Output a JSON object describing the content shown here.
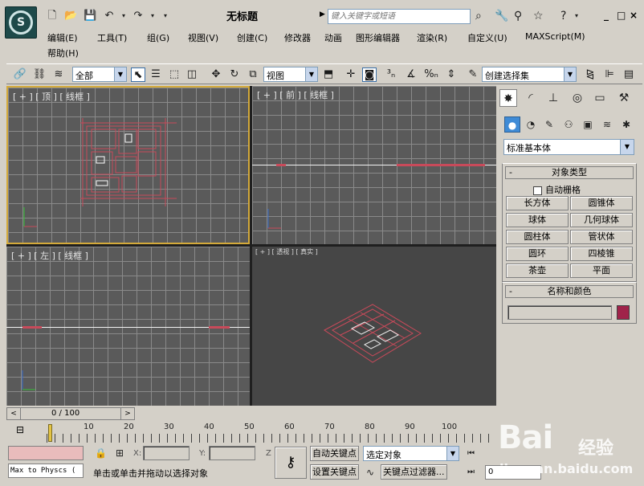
{
  "title_bar": {
    "doc_title": "无标题",
    "search_placeholder": "键入关键字或短语",
    "window_buttons": [
      "_",
      "□",
      "×"
    ],
    "quick_access_icons": [
      "new-file-icon",
      "open-folder-icon",
      "save-icon",
      "undo-icon",
      "redo-icon",
      "dropdown-icon"
    ],
    "right_icons": [
      "binoculars-icon",
      "wrench-icon",
      "satellite-icon",
      "star-icon",
      "help-icon"
    ]
  },
  "menu": {
    "items": [
      {
        "label": "编辑(E)"
      },
      {
        "label": "工具(T)"
      },
      {
        "label": "组(G)"
      },
      {
        "label": "视图(V)"
      },
      {
        "label": "创建(C)"
      },
      {
        "label": "修改器"
      },
      {
        "label": "动画"
      },
      {
        "label": "图形编辑器"
      },
      {
        "label": "渲染(R)"
      },
      {
        "label": "自定义(U)"
      },
      {
        "label": "MAXScript(M)"
      },
      {
        "label": "帮助(H)"
      }
    ]
  },
  "main_toolbar": {
    "selection_filter": "全部",
    "ref_coord": "视图",
    "named_selection": "创建选择集"
  },
  "viewports": {
    "top": {
      "label": "[ + ] [ 顶 ] [ 线框 ]"
    },
    "front": {
      "label": "[ + ] [ 前 ] [ 线框 ]"
    },
    "left": {
      "label": "[ + ] [ 左 ] [ 线框 ]"
    },
    "perspective": {
      "label": "[ + ] [ 透视 ] [ 真实 ]"
    }
  },
  "command_panel": {
    "category": "标准基本体",
    "object_type_title": "对象类型",
    "autogrid_label": "自动栅格",
    "object_buttons": [
      "长方体",
      "圆锥体",
      "球体",
      "几何球体",
      "圆柱体",
      "管状体",
      "圆环",
      "四棱锥",
      "茶壶",
      "平面"
    ],
    "name_color_title": "名称和颜色",
    "swatch_color": "#a0234a"
  },
  "timeline": {
    "slider_value": "0 / 100",
    "tick_labels": [
      "0",
      "10",
      "20",
      "30",
      "40",
      "50",
      "60",
      "70",
      "80",
      "90",
      "100"
    ]
  },
  "status_bar": {
    "maxscript_text": "Max to Physcs (",
    "x_label": "X:",
    "y_label": "Y:",
    "z_label": "Z",
    "prompt": "单击或单击并拖动以选择对象",
    "auto_key": "自动关键点",
    "set_key": "设置关键点",
    "selection_set": "选定对象",
    "key_filters": "关键点过滤器...",
    "frame_value": "0"
  },
  "watermark": {
    "logo": "Bai",
    "text": "经验",
    "url": "jingyan.baidu.com"
  },
  "colors": {
    "active_viewport_border": "#d4aa3a",
    "floorplan_wire": "#c84a5a",
    "chrome": "#d4d0c8"
  }
}
